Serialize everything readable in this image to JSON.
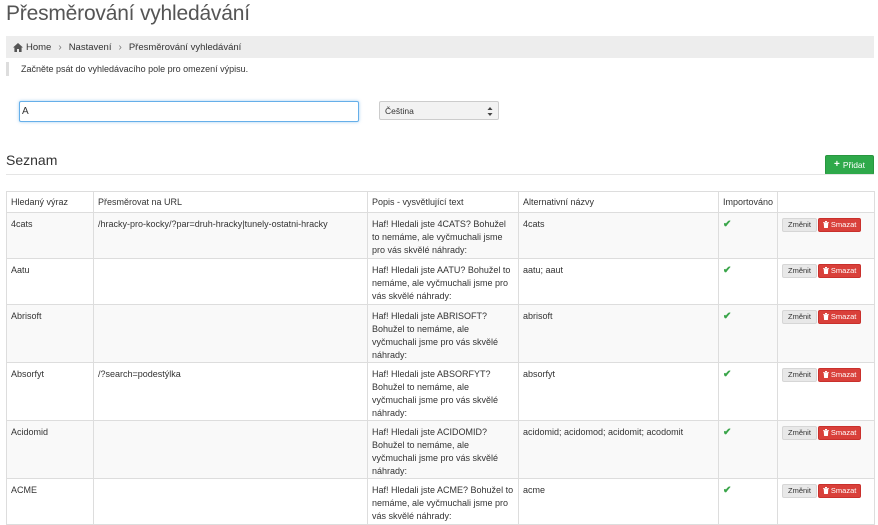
{
  "page": {
    "title": "Přesměrování vyhledávání"
  },
  "breadcrumb": {
    "home": "Home",
    "settings": "Nastavení",
    "current": "Přesměrování vyhledávání",
    "separator": "›"
  },
  "info": {
    "text": "Začněte psát do vyhledávacího pole pro omezení výpisu."
  },
  "search": {
    "value": "A"
  },
  "language": {
    "selected": "Čeština"
  },
  "list": {
    "title": "Seznam",
    "add_label": "Přidat",
    "columns": [
      "Hledaný výraz",
      "Přesměrovat na URL",
      "Popis - vysvětlující text",
      "Alternativní názvy",
      "Importováno",
      ""
    ],
    "edit_label": "Změnit",
    "delete_label": "Smazat",
    "rows": [
      {
        "term": "4cats",
        "url": "/hracky-pro-kocky/?par=druh-hracky|tunely-ostatni-hracky",
        "desc": "Haf! Hledali jste 4CATS? Bohužel to nemáme, ale vyčmuchali jsme pro vás skvělé náhrady:",
        "alt": "4cats",
        "imported": "✔"
      },
      {
        "term": "Aatu",
        "url": "",
        "desc": "Haf! Hledali jste AATU? Bohužel to nemáme, ale vyčmuchali jsme pro vás skvělé náhrady:",
        "alt": "aatu; aaut",
        "imported": "✔"
      },
      {
        "term": "Abrisoft",
        "url": "",
        "desc": "Haf! Hledali jste ABRISOFT? Bohužel to nemáme, ale vyčmuchali jsme pro vás skvělé náhrady:",
        "alt": "abrisoft",
        "imported": "✔"
      },
      {
        "term": "Absorfyt",
        "url": "/?search=podestýlka",
        "desc": "Haf! Hledali jste ABSORFYT? Bohužel to nemáme, ale vyčmuchali jsme pro vás skvělé náhrady:",
        "alt": "absorfyt",
        "imported": "✔"
      },
      {
        "term": "Acidomid",
        "url": "",
        "desc": "Haf! Hledali jste ACIDOMID? Bohužel to nemáme, ale vyčmuchali jsme pro vás skvělé náhrady:",
        "alt": "acidomid; acidomod; acidomit; acodomit",
        "imported": "✔"
      },
      {
        "term": "ACME",
        "url": "",
        "desc": "Haf! Hledali jste ACME? Bohužel to nemáme, ale vyčmuchali jsme pro vás skvělé náhrady:",
        "alt": "acme",
        "imported": "✔"
      }
    ]
  },
  "colors": {
    "add_button": "#2ea94a",
    "delete_button": "#d9403a",
    "check": "#3aa54a",
    "input_focus": "#66afe9"
  }
}
